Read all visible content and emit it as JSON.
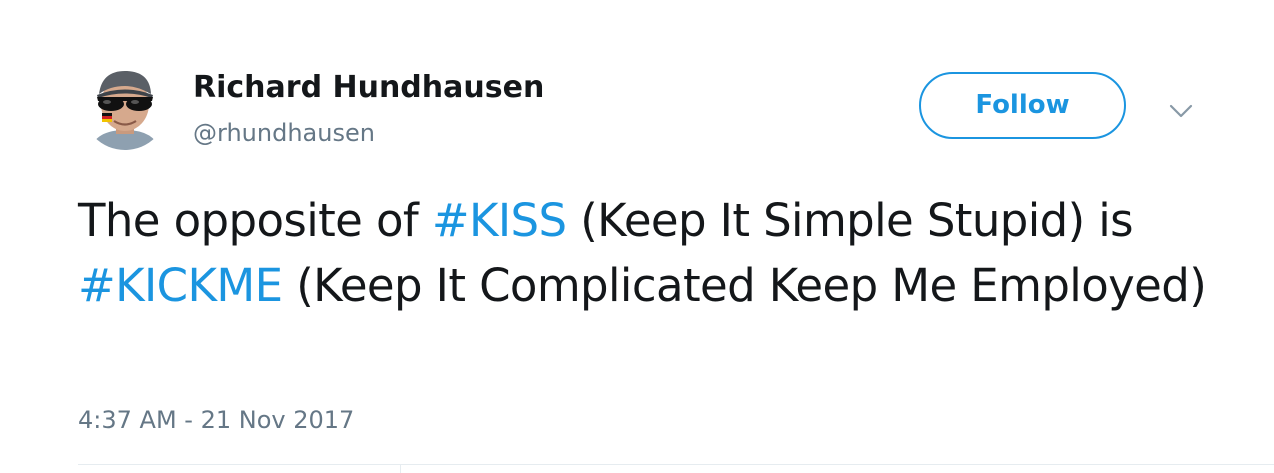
{
  "user": {
    "display_name": "Richard Hundhausen",
    "handle": "@rhundhausen",
    "avatar_icon": "user-avatar"
  },
  "follow": {
    "label": "Follow",
    "color": "#1b95e0"
  },
  "menu": {
    "icon": "chevron-down-icon"
  },
  "tweet": {
    "text_before_1": "The opposite of ",
    "hashtag_1": "#KISS",
    "text_after_1": " (Keep It Simple Stupid) is ",
    "hashtag_2": "#KICKME",
    "text_after_2": " (Keep It Complicated Keep Me Employed)"
  },
  "meta": {
    "timestamp": "4:37 AM - 21 Nov 2017"
  },
  "colors": {
    "text": "#14171a",
    "secondary": "#657786",
    "link": "#1b95e0",
    "border": "#e6ecf0"
  }
}
